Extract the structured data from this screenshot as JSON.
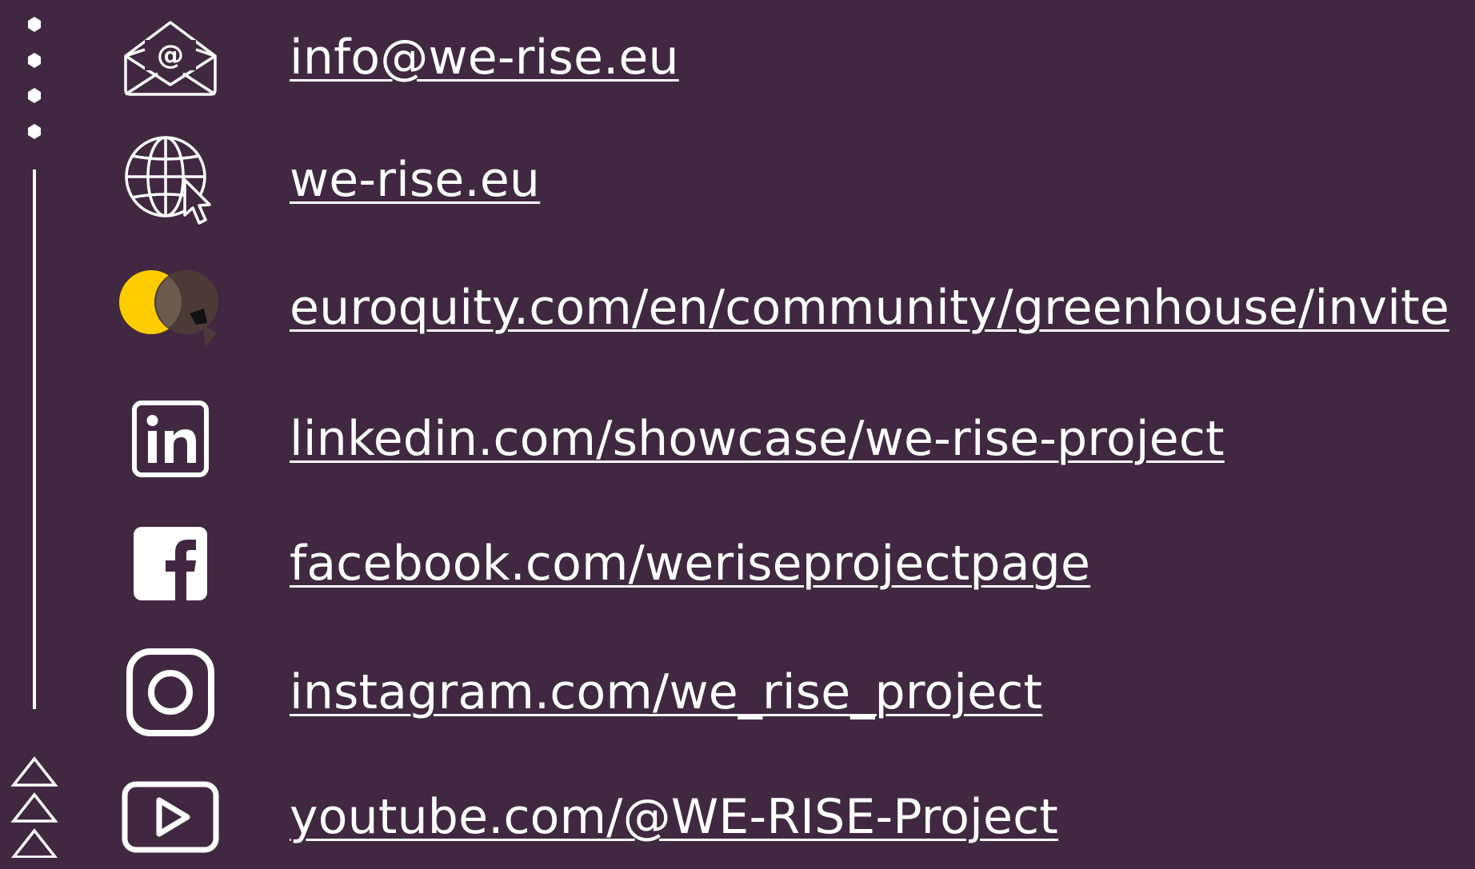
{
  "theme": {
    "background": "#412841",
    "foreground": "#ffffff",
    "euroquity_yellow": "#ffcc00",
    "euroquity_gray": "#5b4a4a"
  },
  "links": [
    {
      "icon": "email-icon",
      "text": "info@we-rise.eu"
    },
    {
      "icon": "website-globe-icon",
      "text": "we-rise.eu"
    },
    {
      "icon": "euroquity-icon",
      "text": "euroquity.com/en/community/greenhouse/invite"
    },
    {
      "icon": "linkedin-icon",
      "text": "linkedin.com/showcase/we-rise-project"
    },
    {
      "icon": "facebook-icon",
      "text": "facebook.com/weriseprojectpage"
    },
    {
      "icon": "instagram-icon",
      "text": "instagram.com/we_rise_project"
    },
    {
      "icon": "youtube-icon",
      "text": "youtube.com/@WE-RISE-Project"
    }
  ]
}
